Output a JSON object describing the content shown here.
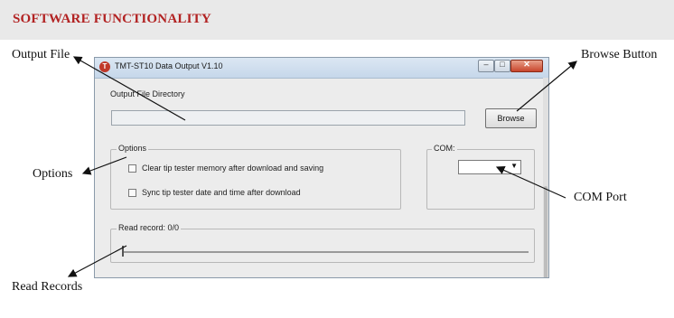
{
  "header": {
    "title": "SOFTWARE FUNCTIONALITY",
    "title_color": "#b22222"
  },
  "callouts": {
    "output_file": "Output File",
    "browse_button": "Browse Button",
    "options": "Options",
    "com_port": "COM Port",
    "read_records": "Read Records"
  },
  "window": {
    "title": "TMT-ST10 Data Output V1.10",
    "app_icon": "app-logo-icon",
    "controls": {
      "minimize": "–",
      "maximize": "□",
      "close": "✕"
    },
    "directory_label": "Output File Directory",
    "directory_value": "",
    "browse_label": "Browse",
    "options": {
      "legend": "Options",
      "items": [
        {
          "label": "Clear tip tester memory after download and saving",
          "checked": false
        },
        {
          "label": "Sync tip tester date and time after download",
          "checked": false
        }
      ]
    },
    "com": {
      "legend": "COM:",
      "selected": ""
    },
    "read_record": {
      "legend": "Read record: 0/0",
      "progress": 0
    }
  }
}
